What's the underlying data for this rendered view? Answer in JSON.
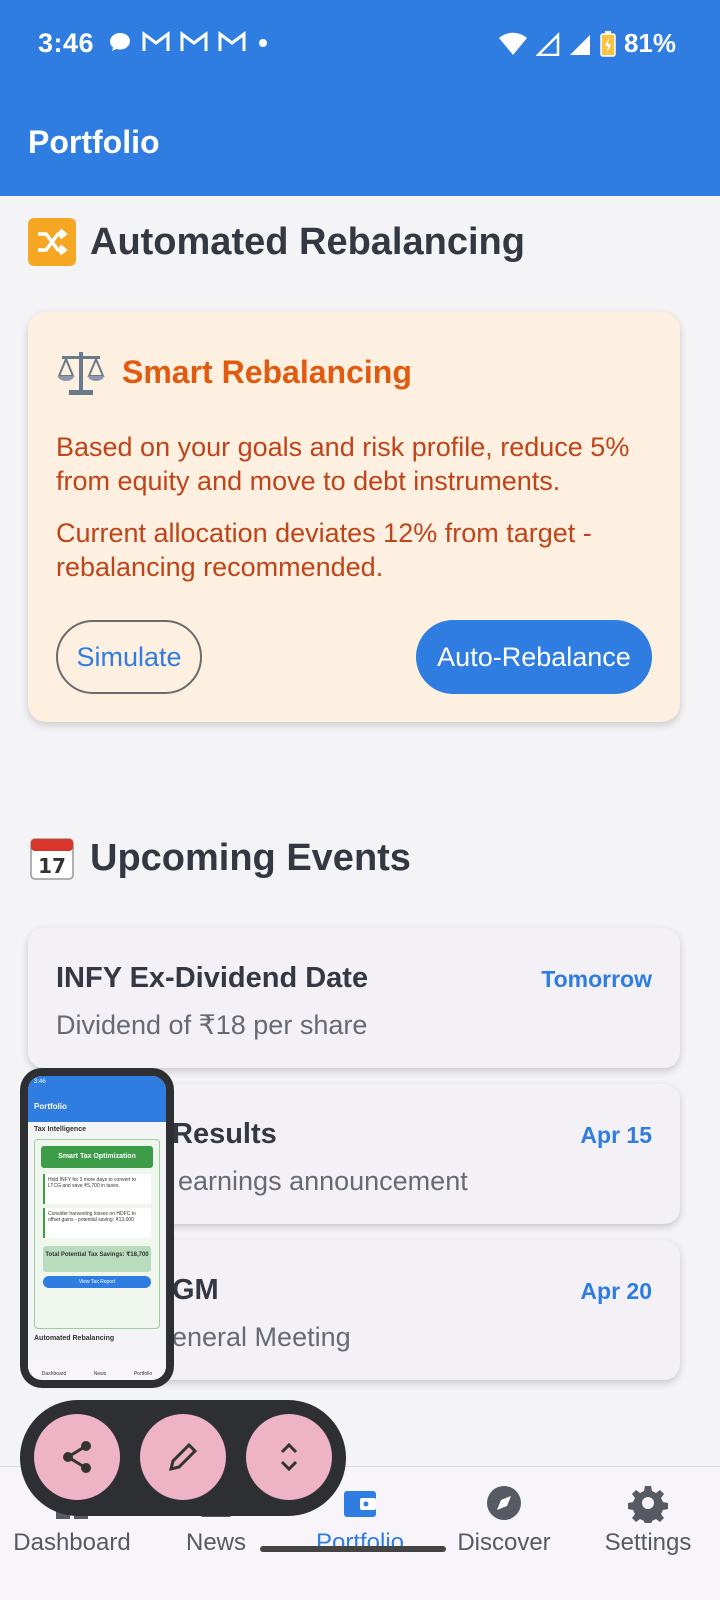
{
  "status": {
    "time": "3:46",
    "battery": "81%",
    "notif_icons": [
      "chat-icon",
      "gmail-icon",
      "gmail-icon",
      "gmail-icon",
      "dot-icon"
    ]
  },
  "app_bar": {
    "title": "Portfolio"
  },
  "rebalancing": {
    "section_title": "Automated Rebalancing",
    "card_title": "Smart Rebalancing",
    "text1": "Based on your goals and risk profile, reduce 5% from equity and move to debt instruments.",
    "text2": "Current allocation deviates 12% from target - rebalancing recommended.",
    "simulate_label": "Simulate",
    "auto_label": "Auto-Rebalance"
  },
  "events": {
    "section_title": "Upcoming Events",
    "items": [
      {
        "title": "INFY Ex-Dividend Date",
        "subtitle": "Dividend of ₹18 per share",
        "date": "Tomorrow"
      },
      {
        "title": "Results",
        "subtitle": "earnings announcement",
        "date": "Apr 15"
      },
      {
        "title": "GM",
        "subtitle": "eneral Meeting",
        "date": "Apr 20"
      }
    ]
  },
  "pip_preview": {
    "app_title": "Portfolio",
    "section": "Tax Intelligence",
    "card_title": "Smart Tax Optimization",
    "tip1": "Hold INFY for 3 more days to convert to LTCG and save ₹5,700 in taxes.",
    "tip2": "Consider harvesting losses on HDFC to offset gains - potential saving: ₹13,000",
    "total": "Total Potential Tax Savings: ₹18,700",
    "button": "View Tax Report",
    "next_section": "Automated Rebalancing"
  },
  "nav": {
    "items": [
      {
        "label": "Dashboard",
        "icon": "dashboard-icon"
      },
      {
        "label": "News",
        "icon": "news-icon"
      },
      {
        "label": "Portfolio",
        "icon": "wallet-icon"
      },
      {
        "label": "Discover",
        "icon": "compass-icon"
      },
      {
        "label": "Settings",
        "icon": "gear-icon"
      }
    ],
    "active": "Portfolio"
  },
  "colors": {
    "primary": "#2f7de1",
    "warning_text": "#c0441a",
    "card_bg": "#fdf0e0",
    "fab": "#eeb4c6"
  }
}
